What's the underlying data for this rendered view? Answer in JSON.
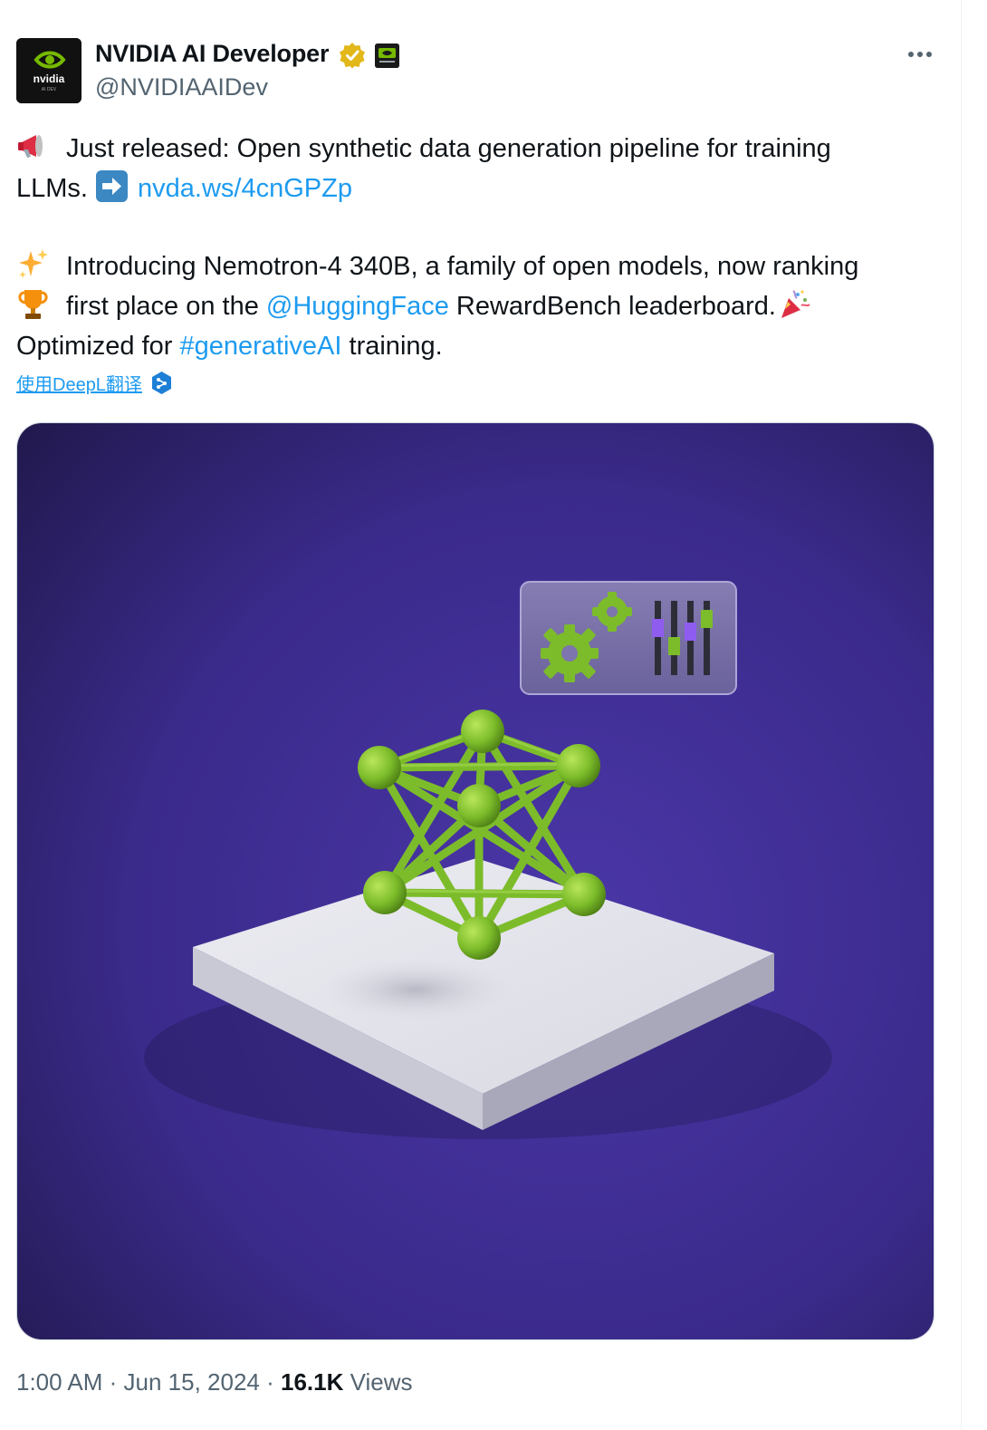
{
  "author": {
    "display_name": "NVIDIA AI Developer",
    "handle": "@NVIDIAAIDev",
    "avatar_text": "nvidia",
    "avatar_subtext": "AI DEV",
    "verified_badge": "gold-check-icon",
    "affiliate_badge": "nvidia-logo-icon"
  },
  "tweet": {
    "line1_text": " Just released: Open synthetic data generation pipeline for training",
    "line2_prefix": "LLMs. ",
    "link": "nvda.ws/4cnGPZp",
    "line3_text": " Introducing Nemotron-4 340B, a family of open models, now ranking",
    "line4_prefix": " first place on the ",
    "mention": "@HuggingFace",
    "line4_suffix": " RewardBench leaderboard.",
    "line5_prefix": "Optimized for ",
    "hashtag": "#generativeAI",
    "line5_suffix": " training.",
    "emojis": [
      "megaphone-icon",
      "right-arrow-icon",
      "sparkles-icon",
      "trophy-icon",
      "party-popper-icon"
    ]
  },
  "translate": {
    "label": "使用DeepL翻译"
  },
  "media": {
    "description_icon": "image-icon"
  },
  "meta": {
    "time": "1:00 AM",
    "sep1": " · ",
    "date": "Jun 15, 2024",
    "sep2": " · ",
    "views_count": "16.1K",
    "views_label": " Views"
  },
  "colors": {
    "link": "#1d9bf0",
    "secondary": "#536471",
    "nvidia_green": "#76b900",
    "media_bg": "#3d2d8c"
  }
}
